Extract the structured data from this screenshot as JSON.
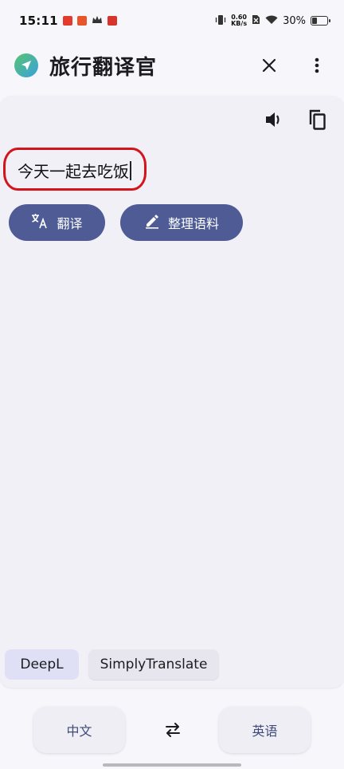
{
  "status_bar": {
    "time": "15:11",
    "net_speed_value": "0.60",
    "net_speed_unit": "KB/s",
    "battery": "30%"
  },
  "app_bar": {
    "title": "旅行翻译官",
    "close_icon": "close-icon",
    "menu_icon": "more-vert-icon"
  },
  "editor": {
    "input_value": "今天一起去吃饭",
    "speak_icon": "volume-icon",
    "copy_icon": "copy-icon"
  },
  "actions": {
    "translate_label": "翻译",
    "organize_label": "整理语料"
  },
  "engines": {
    "items": [
      "DeepL",
      "SimplyTranslate"
    ],
    "selected": "DeepL"
  },
  "languages": {
    "source": "中文",
    "target": "英语",
    "swap_icon": "swap-icon"
  },
  "colors": {
    "accent": "#4e5b94",
    "highlight_ring": "#d4141d",
    "chip_selected": "#dfe0f5"
  }
}
